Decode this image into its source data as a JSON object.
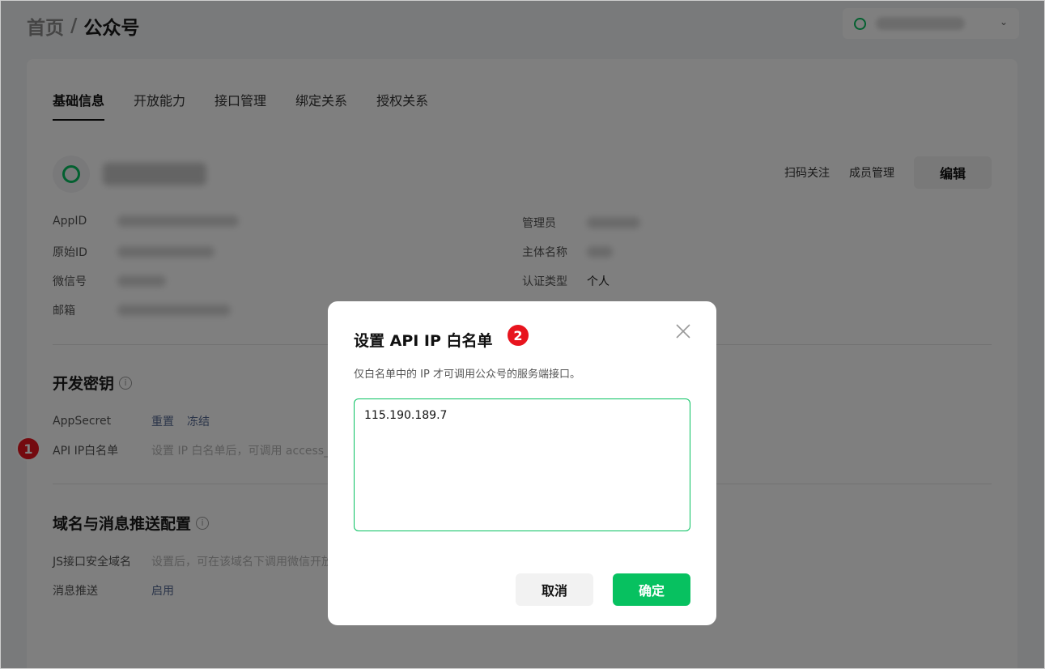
{
  "breadcrumb": {
    "home": "首页",
    "separator": "/",
    "current": "公众号"
  },
  "tabs": [
    {
      "label": "基础信息",
      "active": true
    },
    {
      "label": "开放能力",
      "active": false
    },
    {
      "label": "接口管理",
      "active": false
    },
    {
      "label": "绑定关系",
      "active": false
    },
    {
      "label": "授权关系",
      "active": false
    }
  ],
  "account": {
    "actions": {
      "scan_follow": "扫码关注",
      "member_manage": "成员管理",
      "edit": "编辑"
    }
  },
  "info": {
    "appid_label": "AppID",
    "original_id_label": "原始ID",
    "wechat_id_label": "微信号",
    "email_label": "邮箱",
    "admin_label": "管理员",
    "subject_label": "主体名称",
    "cert_type_label": "认证类型",
    "cert_type_value": "个人"
  },
  "dev_keys": {
    "title": "开发密钥",
    "appsecret_label": "AppSecret",
    "reset": "重置",
    "freeze": "冻结",
    "whitelist_label": "API IP白名单",
    "whitelist_hint": "设置 IP 白名单后，可调用 access_"
  },
  "domain_push": {
    "title": "域名与消息推送配置",
    "js_domain_label": "JS接口安全域名",
    "js_domain_hint": "设置后，可在该域名下调用微信开放",
    "push_label": "消息推送",
    "push_action": "启用"
  },
  "markers": {
    "m1": "1",
    "m2": "2"
  },
  "modal": {
    "title": "设置 API IP 白名单",
    "description": "仅白名单中的 IP 才可调用公众号的服务端接口。",
    "ip_value": "115.190.189.7",
    "cancel": "取消",
    "confirm": "确定"
  },
  "colors": {
    "brand": "#07c160",
    "link": "#576b95",
    "marker": "#e8141e"
  }
}
